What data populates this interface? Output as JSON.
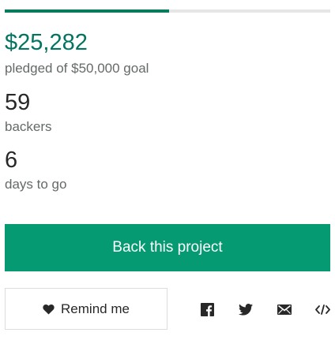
{
  "campaign": {
    "progress_fraction": 0.5057,
    "pledged_amount": "$25,282",
    "pledged_label": "pledged of $50,000 goal",
    "backers_count": "59",
    "backers_label": "backers",
    "days_count": "6",
    "days_label": "days to go"
  },
  "actions": {
    "back_label": "Back this project",
    "remind_label": "Remind me"
  },
  "share": {
    "icons": [
      "facebook-icon",
      "twitter-icon",
      "email-icon",
      "embed-icon"
    ]
  },
  "colors": {
    "accent": "#069a73",
    "progress": "#0a7c5e",
    "pledged_text": "#037362",
    "muted_text": "#656969",
    "track": "#e6e6e6"
  }
}
